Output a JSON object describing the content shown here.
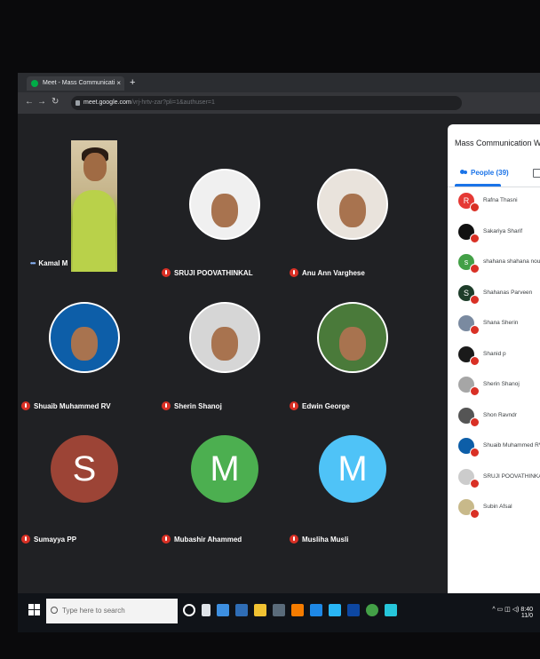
{
  "browser": {
    "tab_title": "Meet - Mass Communicati",
    "tab_close": "×",
    "new_tab": "+",
    "url_domain": "meet.google.com",
    "url_path": "/vrj-hrtv-zar?pli=1&authuser=1"
  },
  "meeting": {
    "self_name": "Kamal M",
    "participants_grid": [
      {
        "name": "SRUJI POOVATHINKAL",
        "type": "photo",
        "color": "#f0f0f0"
      },
      {
        "name": "Anu Ann Varghese",
        "type": "photo",
        "color": "#e9e3dc"
      },
      {
        "name": "Shuaib Muhammed RV",
        "type": "photo",
        "color": "#0d5ea8"
      },
      {
        "name": "Sherin Shanoj",
        "type": "photo",
        "color": "#d6d6d6"
      },
      {
        "name": "Edwin George",
        "type": "photo",
        "color": "#4a7a3a"
      },
      {
        "name": "Sumayya PP",
        "type": "initial",
        "initial": "S",
        "color": "#9c4436"
      },
      {
        "name": "Mubashir Ahammed",
        "type": "initial",
        "initial": "M",
        "color": "#4caf50"
      },
      {
        "name": "Musliha Musli",
        "type": "initial",
        "initial": "M",
        "color": "#4fc3f7"
      }
    ]
  },
  "panel": {
    "title": "Mass Communication Webi",
    "people_tab": "People (39)",
    "participants": [
      {
        "name": "Rafna Thasni",
        "initial": "R",
        "color": "#e53935"
      },
      {
        "name": "Sakariya Sharif",
        "initial": "",
        "color": "#111111"
      },
      {
        "name": "shahana shahana noure",
        "initial": "s",
        "color": "#43a047"
      },
      {
        "name": "Shahanas Parveen",
        "initial": "S",
        "color": "#1e3d2a"
      },
      {
        "name": "Shana Sherin",
        "initial": "",
        "color": "#7a8aa0"
      },
      {
        "name": "Shanid p",
        "initial": "",
        "color": "#1a1a1a"
      },
      {
        "name": "Sherin Shanoj",
        "initial": "",
        "color": "#a6a6a6"
      },
      {
        "name": "Shon Ravndr",
        "initial": "",
        "color": "#555555"
      },
      {
        "name": "Shuaib Muhammed RV",
        "initial": "",
        "color": "#0d5ea8"
      },
      {
        "name": "SRUJI POOVATHINKAL",
        "initial": "",
        "color": "#cccccc"
      },
      {
        "name": "Subin Afsal",
        "initial": "",
        "color": "#c8b98a"
      }
    ]
  },
  "taskbar": {
    "search_placeholder": "Type here to search",
    "time": "8:40",
    "date": "11/0"
  }
}
